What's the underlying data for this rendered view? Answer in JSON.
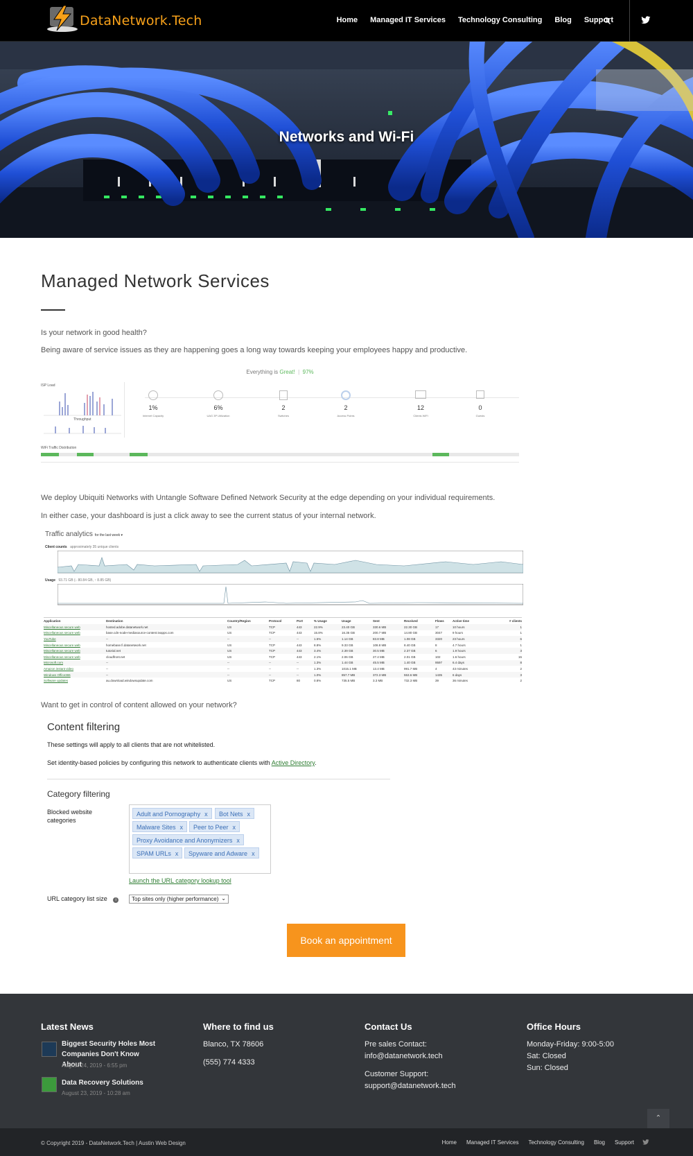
{
  "header": {
    "brand": "DataNetwork.Tech",
    "nav": [
      "Home",
      "Managed IT Services",
      "Technology Consulting",
      "Blog",
      "Support"
    ],
    "search_icon": "search-icon",
    "social_icon": "twitter-icon"
  },
  "hero": {
    "title": "Networks and Wi-Fi"
  },
  "content": {
    "heading": "Managed Network Services",
    "p1": "Is your network in good health?",
    "p2": "Being aware of service issues as they are happening goes a long way towards keeping your employees happy and productive.",
    "p3": "We deploy Ubiquiti Networks with Untangle Software Defined Network Security at the edge depending on your individual requirements.",
    "p4": "In either case, your dashboard is just a click away to see the current status of your internal network.",
    "p5": "Want to get in control of content allowed on your network?"
  },
  "dashboard": {
    "status": "Everything is",
    "status_word": "Great!",
    "status_pct": "97%",
    "stats": [
      {
        "value": "1%",
        "label": "Internet Capacity"
      },
      {
        "value": "6%",
        "label": "UAG 3P Utilization"
      },
      {
        "value": "2",
        "label": "Switches"
      },
      {
        "value": "2",
        "label": "Access Points"
      },
      {
        "value": "12",
        "label": "Clients WiFi"
      },
      {
        "value": "0",
        "label": "Guests"
      }
    ],
    "throughput_label": "Throughput",
    "wifi_label": "WiFi Traffic Distribution",
    "wan_label": "ISP Load"
  },
  "traffic": {
    "title": "Traffic analytics",
    "period": "for the last week ▾",
    "client_counts": "Client counts",
    "client_sub": "approximately 35 unique clients",
    "usage": "Usage",
    "usage_sub": "93.71 GB (↓ 80.84 GB, ↑ 8.85 GB)",
    "columns": [
      "Application",
      "Destination",
      "Country/Region",
      "Protocol",
      "Port",
      "% Usage",
      "Usage",
      "Sent",
      "Received",
      "Flows",
      "Active time",
      "# clients"
    ],
    "rows": [
      [
        "Miscellaneous secure web",
        "hosted.adobe.datanetwork.net",
        "US",
        "TCP",
        "443",
        "22.9%",
        "23.40 GB",
        "330.6 MB",
        "22.30 GB",
        "17",
        "10 hours",
        "1"
      ],
      [
        "Miscellaneous secure web",
        "base.cdn-node-mediasource-content.tvapps.com",
        "US",
        "TCP",
        "443",
        "15.8%",
        "16.35 GB",
        "200.7 MB",
        "14.80 GB",
        "3047",
        "9 hours",
        "1"
      ],
      [
        "YouTube",
        "--",
        "--",
        "--",
        "--",
        "1.5%",
        "1.14 GB",
        "83.8 MB",
        "1.08 GB",
        "3320",
        "23 hours",
        "6"
      ],
      [
        "Miscellaneous secure web",
        "homebase.fi.datanetwork.net",
        "US",
        "TCP",
        "443",
        "8.8%",
        "9.33 GB",
        "108.8 MB",
        "8.40 GB",
        "8",
        "4.7 hours",
        "1"
      ],
      [
        "Miscellaneous secure web",
        "tutorial.net",
        "US",
        "TCP",
        "443",
        "3.4%",
        "2.39 GB",
        "30.5 MB",
        "2.37 GB",
        "6",
        "1.9 hours",
        "3"
      ],
      [
        "Miscellaneous secure web",
        "cloudfront.net",
        "US",
        "TCP",
        "443",
        "2.1%",
        "2.06 GB",
        "27.4 MB",
        "2.01 GB",
        "102",
        "1.6 hours",
        "15"
      ],
      [
        "Microsoft.com",
        "--",
        "--",
        "--",
        "--",
        "1.3%",
        "1.44 GB",
        "45.5 MB",
        "1.40 GB",
        "9597",
        "6.4 days",
        "8"
      ],
      [
        "Amazon instant video",
        "--",
        "--",
        "--",
        "--",
        "1.3%",
        "1015.1 MB",
        "13.4 MB",
        "991.7 MB",
        "4",
        "43 minutes",
        "2"
      ],
      [
        "Windows Office365",
        "--",
        "--",
        "--",
        "--",
        "1.0%",
        "857.7 MB",
        "372.3 MB",
        "553.6 MB",
        "1435",
        "6 days",
        "3"
      ],
      [
        "Software updates",
        "au.download.windowsupdate.com",
        "US",
        "TCP",
        "80",
        "0.8%",
        "735.5 MB",
        "3.3 MB",
        "732.3 MB",
        "39",
        "36 minutes",
        "2"
      ]
    ]
  },
  "content_filtering": {
    "title": "Content filtering",
    "line1": "These settings will apply to all clients that are not whitelisted.",
    "line2": "Set identity-based policies by configuring this network to authenticate clients with",
    "link": "Active Directory",
    "line2_end": ".",
    "category_title": "Category filtering",
    "blocked_label": "Blocked website categories",
    "tags": [
      "Adult and Pornography",
      "Bot Nets",
      "Malware Sites",
      "Peer to Peer",
      "Proxy Avoidance and Anonymizers",
      "SPAM URLs",
      "Spyware and Adware"
    ],
    "tool_link": "Launch the URL category lookup tool",
    "list_size_label": "URL category list size",
    "list_size_value": "Top sites only (higher performance)"
  },
  "cta": {
    "label": "Book an appointment"
  },
  "footer": {
    "news_title": "Latest News",
    "news": [
      {
        "title": "Biggest Security Holes Most Companies Don't Know About",
        "date": "August 24, 2019 - 6:55 pm"
      },
      {
        "title": "Data Recovery Solutions",
        "date": "August 23, 2019 - 10:28 am"
      }
    ],
    "find_title": "Where to find us",
    "address": "Blanco, TX 78606",
    "phone": "(555) 774 4333",
    "contact_title": "Contact Us",
    "presales_label": "Pre sales Contact:",
    "presales_email": "info@datanetwork.tech",
    "support_label": "Customer Support:",
    "support_email": "support@datanetwork.tech",
    "hours_title": "Office Hours",
    "hours": [
      "Monday-Friday: 9:00-5:00",
      "Sat: Closed",
      "Sun: Closed"
    ],
    "copyright": "© Copyright 2019 - DataNetwork.Tech | Austin Web Design",
    "sub_nav": [
      "Home",
      "Managed IT Services",
      "Technology Consulting",
      "Blog",
      "Support"
    ]
  },
  "colors": {
    "brand": "#f7a11a",
    "cta": "#f7941d",
    "header_bg": "#000000",
    "footer_bg": "#33363a",
    "status_green": "#5cb85c"
  }
}
